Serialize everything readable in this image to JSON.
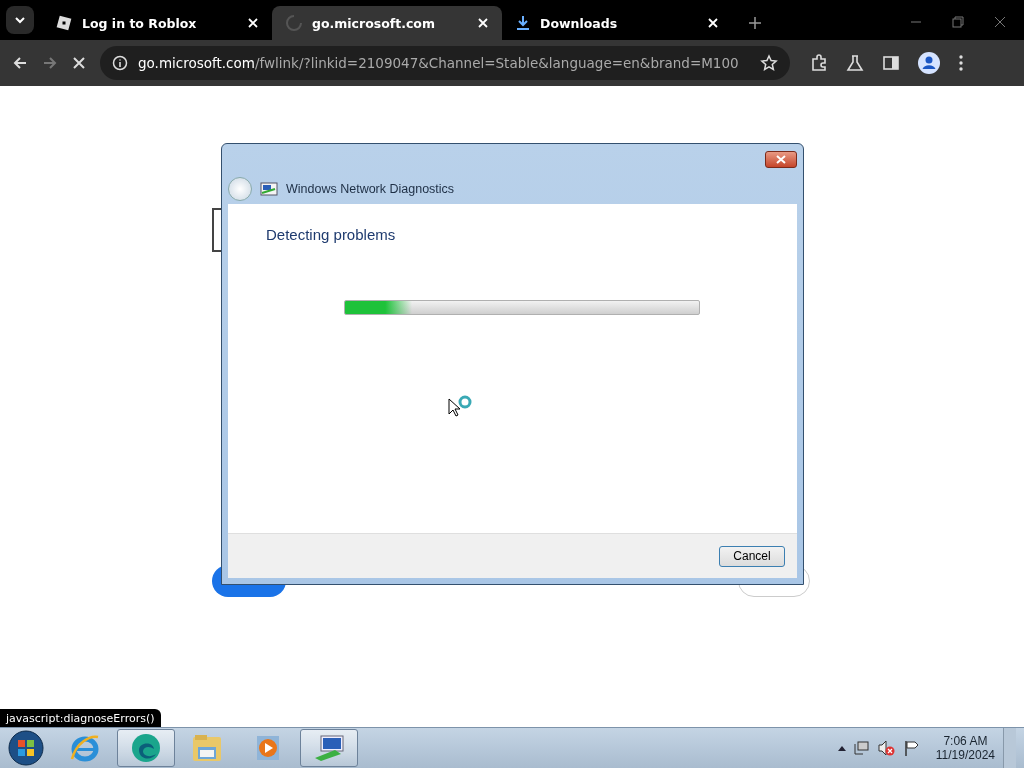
{
  "browser": {
    "tabs": [
      {
        "label": "Log in to Roblox",
        "kind": "site",
        "selected": false
      },
      {
        "label": "go.microsoft.com",
        "kind": "loading",
        "selected": true
      },
      {
        "label": "Downloads",
        "kind": "downloads",
        "selected": false
      }
    ],
    "address": {
      "host": "go.microsoft.com",
      "path": "/fwlink/?linkid=2109047&Channel=Stable&language=en&brand=M100"
    },
    "status_link": "javascript:diagnoseErrors()"
  },
  "dialog": {
    "title": "Windows Network Diagnostics",
    "heading": "Detecting problems",
    "progress": {
      "level": 0.19
    },
    "buttons": [
      "Cancel"
    ]
  },
  "taskbar": {
    "apps": [
      {
        "kind": "ie",
        "running": false
      },
      {
        "kind": "edge",
        "running": true
      },
      {
        "kind": "explorer",
        "running": false
      },
      {
        "kind": "media",
        "running": false
      },
      {
        "kind": "network",
        "running": true
      }
    ],
    "clock": {
      "time": "7:06 AM",
      "date": "11/19/2024"
    }
  }
}
